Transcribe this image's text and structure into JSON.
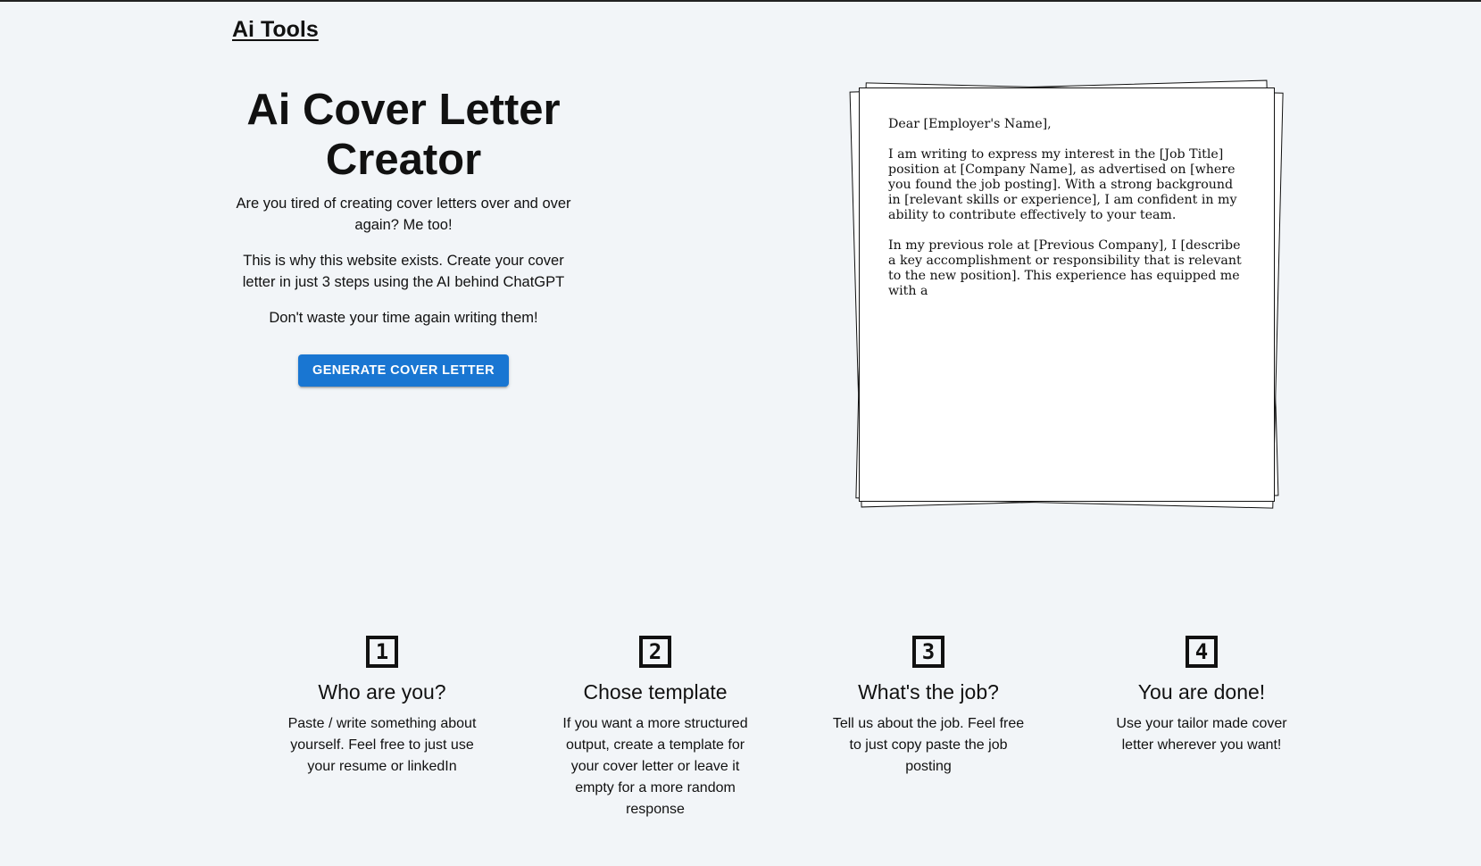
{
  "nav": {
    "brand": "Ai Tools"
  },
  "hero": {
    "title": "Ai Cover Letter Creator",
    "paragraphs": [
      "Are you tired of creating cover letters over and over again? Me too!",
      "This is why this website exists. Create your cover letter in just 3 steps using the AI behind ChatGPT",
      "Don't waste your time again writing them!"
    ],
    "cta_label": "Generate Cover Letter"
  },
  "letter": {
    "paragraphs": [
      "Dear [Employer's Name],",
      "I am writing to express my interest in the [Job Title] position at [Company Name], as advertised on [where you found the job posting]. With a strong background in [relevant skills or experience], I am confident in my ability to contribute effectively to your team.",
      "In my previous role at [Previous Company], I [describe a key accomplishment or responsibility that is relevant to the new position]. This experience has equipped me with a"
    ]
  },
  "steps": [
    {
      "number": "1",
      "title": "Who are you?",
      "description": "Paste / write something about yourself. Feel free to just use your resume or linkedIn"
    },
    {
      "number": "2",
      "title": "Chose template",
      "description": "If you want a more structured output, create a template for your cover letter or leave it empty for a more random response"
    },
    {
      "number": "3",
      "title": "What's the job?",
      "description": "Tell us about the job. Feel free to just copy paste the job posting"
    },
    {
      "number": "4",
      "title": "You are done!",
      "description": "Use your tailor made cover letter wherever you want!"
    }
  ],
  "colors": {
    "background": "#f2f5f8",
    "accent": "#1976d2"
  }
}
